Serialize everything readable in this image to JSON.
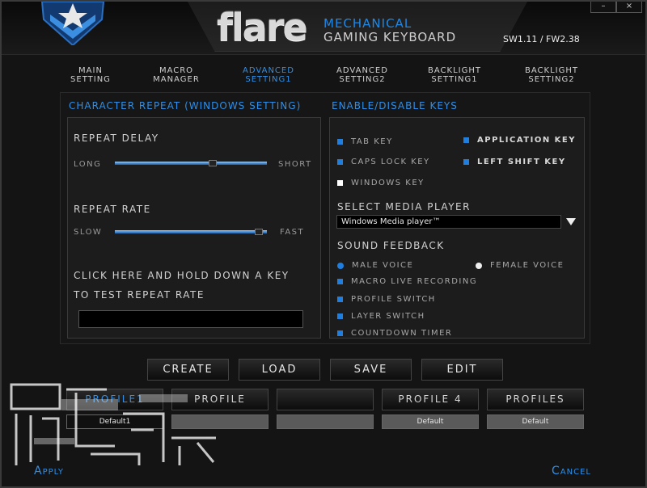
{
  "window": {
    "close_symbol": "×"
  },
  "brand": {
    "logo_text": "flare",
    "subtitle_top": "MECHANICAL",
    "subtitle_bottom": "GAMING KEYBOARD",
    "version": "SW1.11 / FW2.38"
  },
  "tabs": [
    {
      "line1": "MAIN",
      "line2": "SETTING",
      "active": false
    },
    {
      "line1": "MACRO",
      "line2": "MANAGER",
      "active": false
    },
    {
      "line1": "ADVANCED",
      "line2": "SETTING1",
      "active": true
    },
    {
      "line1": "ADVANCED",
      "line2": "SETTING2",
      "active": false
    },
    {
      "line1": "BACKLIGHT",
      "line2": "SETTING1",
      "active": false
    },
    {
      "line1": "BACKLIGHT",
      "line2": "SETTING2",
      "active": false
    }
  ],
  "char_repeat": {
    "title": "CHARACTER REPEAT (WINDOWS SETTING)",
    "repeat_delay": {
      "label": "REPEAT DELAY",
      "min_label": "LONG",
      "max_label": "SHORT",
      "value": 0.65
    },
    "repeat_rate": {
      "label": "REPEAT RATE",
      "min_label": "SLOW",
      "max_label": "FAST",
      "value": 0.97
    },
    "test_line1": "CLICK HERE AND HOLD DOWN A KEY",
    "test_line2": "TO TEST REPEAT RATE",
    "test_value": ""
  },
  "keys": {
    "title": "ENABLE/DISABLE KEYS",
    "tab_key": "TAB KEY",
    "caps_lock_key": "CAPS LOCK KEY",
    "windows_key": "WINDOWS KEY",
    "application_key": "APPLICATION KEY",
    "left_shift_key": "LEFT SHIFT KEY"
  },
  "media": {
    "label": "SELECT MEDIA PLAYER",
    "selected": "Windows Media player™"
  },
  "sound": {
    "label": "SOUND FEEDBACK",
    "male": "MALE VOICE",
    "female": "FEMALE VOICE",
    "macro_live": "MACRO LIVE RECORDING",
    "profile_switch": "PROFILE SWITCH",
    "layer_switch": "LAYER SWITCH",
    "countdown": "COUNTDOWN TIMER"
  },
  "actions": {
    "create": "CREATE",
    "load": "LOAD",
    "save": "SAVE",
    "edit": "EDIT"
  },
  "profiles": [
    {
      "label": "PROFILE1",
      "name": "Default1"
    },
    {
      "label": "PROFILE",
      "name": ""
    },
    {
      "label": "",
      "name": ""
    },
    {
      "label": "PROFILE 4",
      "name": "Default"
    },
    {
      "label": "PROFILES",
      "name": "Default"
    }
  ],
  "footer": {
    "apply": "Apply",
    "cancel": "Cancel"
  },
  "colors": {
    "accent": "#2f8fe8",
    "checkbox": "#1e7fe0"
  }
}
